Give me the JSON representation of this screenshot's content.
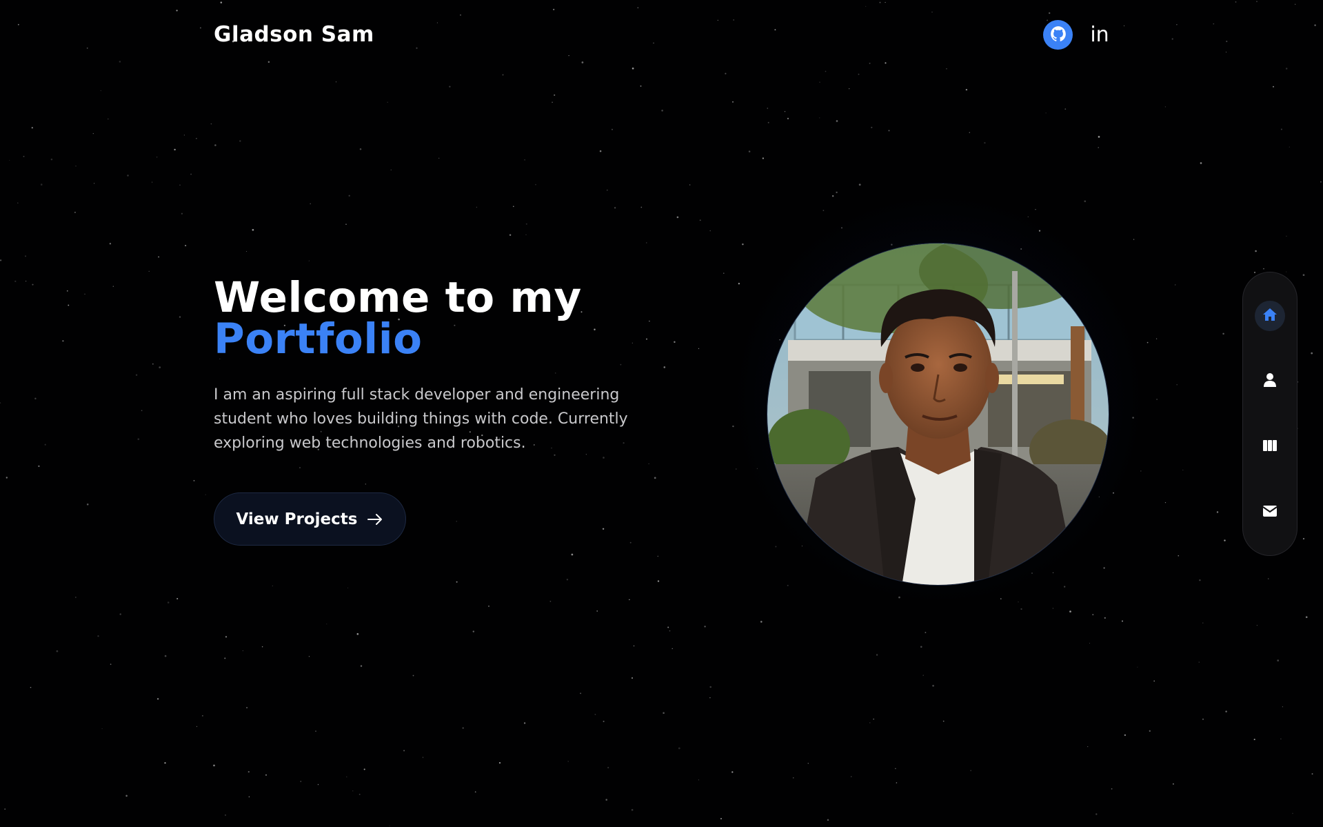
{
  "header": {
    "brand": "Gladson Sam",
    "social": [
      {
        "name": "GitHub",
        "icon": "github-icon"
      },
      {
        "name": "LinkedIn",
        "icon": "linkedin-icon",
        "text": "in"
      }
    ]
  },
  "hero": {
    "title_line1": "Welcome to my",
    "title_line2": "Portfolio",
    "description": "I am an aspiring full stack developer and engineering student who loves building things with code. Currently exploring web technologies and robotics.",
    "cta_label": "View Projects"
  },
  "sidenav": {
    "items": [
      {
        "icon": "home-icon",
        "active": true
      },
      {
        "icon": "user-icon",
        "active": false
      },
      {
        "icon": "projects-icon",
        "active": false
      },
      {
        "icon": "mail-icon",
        "active": false
      }
    ]
  },
  "colors": {
    "background": "#010102",
    "accent": "#3b82f6",
    "text": "#ffffff",
    "muted": "#c9c9cc"
  }
}
